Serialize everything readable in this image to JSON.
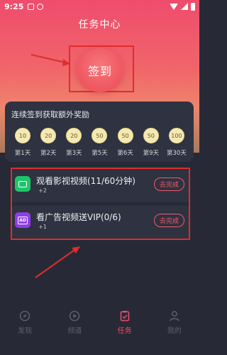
{
  "status_bar": {
    "time": "9:25"
  },
  "page_title": "任务中心",
  "sign_in": {
    "label": "签到"
  },
  "streak": {
    "title": "连续签到获取额外奖励",
    "items": [
      {
        "points": "10",
        "day": "第1天"
      },
      {
        "points": "20",
        "day": "第2天"
      },
      {
        "points": "20",
        "day": "第3天"
      },
      {
        "points": "50",
        "day": "第5天"
      },
      {
        "points": "50",
        "day": "第6天"
      },
      {
        "points": "50",
        "day": "第9天"
      },
      {
        "points": "100",
        "day": "第30天"
      }
    ]
  },
  "tasks": [
    {
      "title": "观看影视视频(11/60分钟)",
      "reward": "+2",
      "action": "去完成",
      "icon": "tv-icon"
    },
    {
      "title": "看广告视频送VIP(0/6)",
      "reward": "+1",
      "action": "去完成",
      "icon": "ad-icon"
    }
  ],
  "tabs": [
    {
      "label": "发现",
      "icon": "compass-icon"
    },
    {
      "label": "频道",
      "icon": "play-icon"
    },
    {
      "label": "任务",
      "icon": "task-icon",
      "active": true
    },
    {
      "label": "我的",
      "icon": "user-icon"
    }
  ],
  "colors": {
    "accent": "#ef4c6c",
    "annotation": "#e02d2d",
    "card": "#2f3240",
    "background": "#272a36"
  }
}
